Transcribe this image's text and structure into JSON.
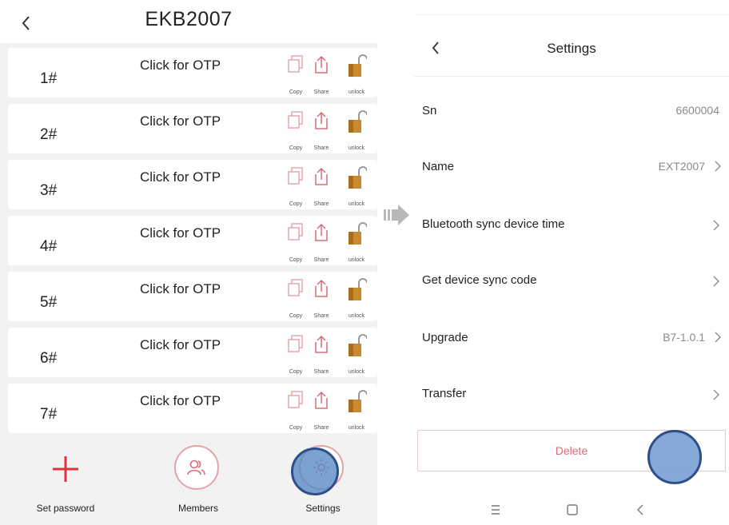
{
  "left": {
    "title": "EKB2007",
    "rows": [
      {
        "num": "1#",
        "otp": "Click for OTP"
      },
      {
        "num": "2#",
        "otp": "Click for OTP"
      },
      {
        "num": "3#",
        "otp": "Click for OTP"
      },
      {
        "num": "4#",
        "otp": "Click for OTP"
      },
      {
        "num": "5#",
        "otp": "Click for OTP"
      },
      {
        "num": "6#",
        "otp": "Click for OTP"
      },
      {
        "num": "7#",
        "otp": "Click for OTP"
      }
    ],
    "actions": {
      "copy": "Copy",
      "share": "Share",
      "unlock": "unlock"
    },
    "bottom": {
      "set_password": "Set password",
      "members": "Members",
      "settings": "Settings"
    }
  },
  "right": {
    "title": "Settings",
    "rows": {
      "sn": {
        "label": "Sn",
        "value": "6600004"
      },
      "name": {
        "label": "Name",
        "value": "EXT2007"
      },
      "bt_sync": {
        "label": "Bluetooth sync device time"
      },
      "sync_code": {
        "label": "Get device sync code"
      },
      "upgrade": {
        "label": "Upgrade",
        "value": "B7-1.0.1"
      },
      "transfer": {
        "label": "Transfer"
      }
    },
    "delete_label": "Delete"
  },
  "colors": {
    "accent_red": "#e0313f",
    "pink_outline": "#e3a3aa",
    "lock_brown": "#c98a2e",
    "tap_marker": "#5489c4"
  }
}
